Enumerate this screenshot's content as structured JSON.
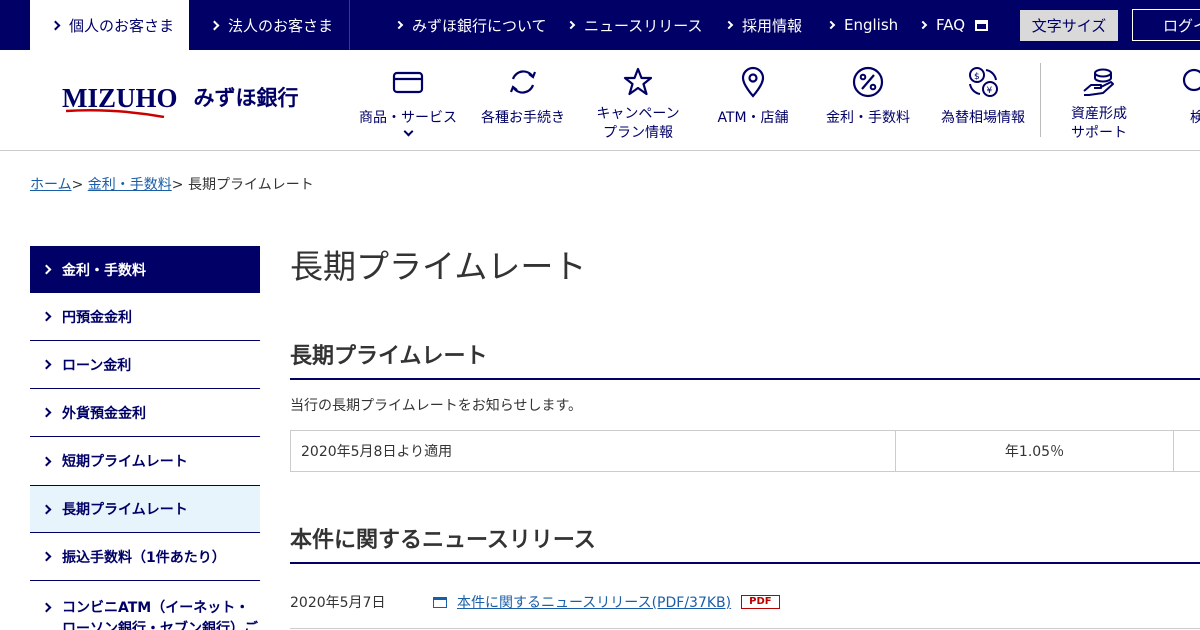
{
  "topbar": {
    "tab_personal": "個人のお客さま",
    "tab_corporate": "法人のお客さま",
    "links": [
      "みずほ銀行について",
      "ニュースリリース",
      "採用情報",
      "English",
      "FAQ"
    ],
    "font_size_label": "文字サイズ",
    "login_label": "ログイ"
  },
  "header": {
    "logo_en": "MIZUHO",
    "logo_jp": "みずほ銀行",
    "nav": [
      {
        "label": "商品・サービス",
        "icon": "card-icon"
      },
      {
        "label": "各種お手続き",
        "icon": "refresh-icon"
      },
      {
        "label": "キャンペーン\nプラン情報",
        "icon": "star-icon"
      },
      {
        "label": "ATM・店舗",
        "icon": "map-pin-icon"
      },
      {
        "label": "金利・手数料",
        "icon": "percent-icon"
      },
      {
        "label": "為替相場情報",
        "icon": "exchange-icon"
      },
      {
        "label": "資産形成\nサポート",
        "icon": "hand-coins-icon"
      },
      {
        "label": "検",
        "icon": "search-icon"
      }
    ]
  },
  "breadcrumb": {
    "home": "ホーム",
    "sep": ">",
    "parent": "金利・手数料",
    "current": "長期プライムレート"
  },
  "sidebar": {
    "heading": "金利・手数料",
    "items": [
      "円預金金利",
      "ローン金利",
      "外貨預金金利",
      "短期プライムレート",
      "長期プライムレート",
      "振込手数料（1件あたり）",
      "コンビニATM（イーネット・ローソン銀行・セブン銀行）ご"
    ]
  },
  "main": {
    "page_title": "長期プライムレート",
    "section1_title": "長期プライムレート",
    "intro": "当行の長期プライムレートをお知らせします。",
    "rate_date": "2020年5月8日より適用",
    "rate_value": "年1.05％",
    "section2_title": "本件に関するニュースリリース",
    "news_date": "2020年5月7日",
    "news_link": "本件に関するニュースリリース(PDF/37KB)",
    "pdf_badge": "PDF"
  },
  "colors": {
    "brand_navy": "#000066",
    "link_blue": "#1a5ea8",
    "active_bg": "#e8f4fb",
    "pdf_red": "#bb0000"
  }
}
